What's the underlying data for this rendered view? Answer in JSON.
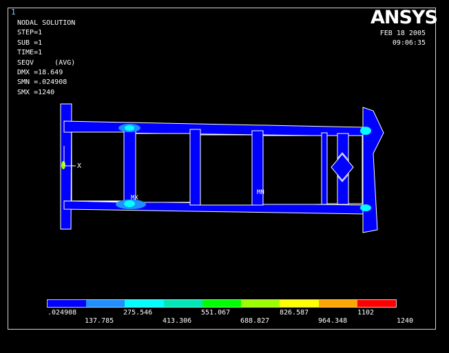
{
  "window": {
    "number": "1"
  },
  "brand": {
    "logo_text": "ANSYS"
  },
  "header": {
    "lines": [
      "NODAL SOLUTION",
      "",
      "STEP=1",
      "SUB =1",
      "TIME=1",
      "SEQV     (AVG)",
      "DMX =18.649",
      "SMN =.024908",
      "SMX =1240"
    ],
    "date": "FEB 18 2005",
    "time": "09:06:35"
  },
  "plot": {
    "axis_label": "X",
    "min_marker": "MN",
    "max_marker": "MX"
  },
  "legend": {
    "colors": [
      "#0000ff",
      "#1e90ff",
      "#00ffff",
      "#00e8b8",
      "#00ff00",
      "#9cff00",
      "#ffff00",
      "#ffa500",
      "#ff0000"
    ],
    "labels_top": [
      ".024908",
      "275.546",
      "551.067",
      "826.587",
      "1102"
    ],
    "labels_bottom": [
      "137.785",
      "413.306",
      "688.827",
      "964.348",
      "1240"
    ]
  },
  "palette": {
    "structure": "#0000ff",
    "highlight": "#00ffff",
    "edge": "#ffffff"
  }
}
